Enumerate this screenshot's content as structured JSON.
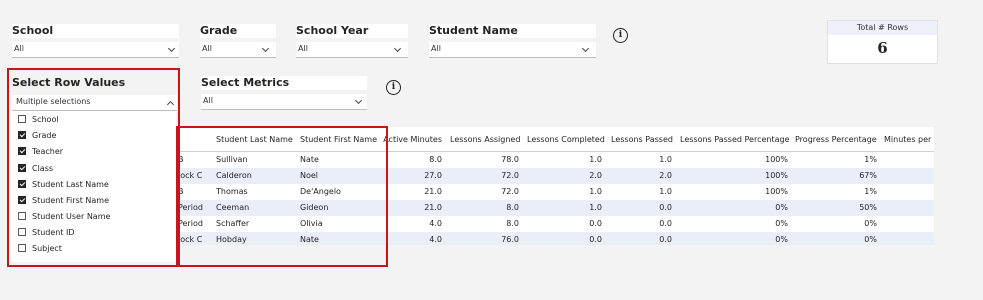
{
  "filters": {
    "school": {
      "title": "School",
      "value": "All"
    },
    "grade": {
      "title": "Grade",
      "value": "All"
    },
    "school_year": {
      "title": "School Year",
      "value": "All"
    },
    "student_name": {
      "title": "Student Name",
      "value": "All"
    },
    "select_row_values": {
      "title": "Select Row Values",
      "value": "Multiple selections"
    },
    "select_metrics": {
      "title": "Select Metrics",
      "value": "All"
    }
  },
  "info_icon_glyph": "i",
  "card": {
    "title": "Total # Rows",
    "value": "6"
  },
  "row_values": [
    {
      "label": "School",
      "checked": false
    },
    {
      "label": "Grade",
      "checked": true
    },
    {
      "label": "Teacher",
      "checked": true
    },
    {
      "label": "Class",
      "checked": true
    },
    {
      "label": "Student Last Name",
      "checked": true
    },
    {
      "label": "Student First Name",
      "checked": true
    },
    {
      "label": "Student User Name",
      "checked": false
    },
    {
      "label": "Student ID",
      "checked": false
    },
    {
      "label": "Subject",
      "checked": false
    }
  ],
  "table": {
    "headers": [
      "Student Last Name",
      "Student First Name",
      "Active Minutes",
      "Lessons Assigned",
      "Lessons Completed",
      "Lessons Passed",
      "Lessons Passed Percentage",
      "Progress Percentage",
      "Minutes per Week"
    ],
    "rows": [
      [
        "B",
        "Sullivan",
        "Nate",
        "8.0",
        "78.0",
        "1.0",
        "1.0",
        "100%",
        "1%"
      ],
      [
        "lock C",
        "Calderon",
        "Noel",
        "27.0",
        "72.0",
        "2.0",
        "2.0",
        "100%",
        "67%"
      ],
      [
        "B",
        "Thomas",
        "De'Angelo",
        "21.0",
        "72.0",
        "1.0",
        "1.0",
        "100%",
        "1%"
      ],
      [
        "Period",
        "Ceeman",
        "Gideon",
        "21.0",
        "8.0",
        "1.0",
        "0.0",
        "0%",
        "50%"
      ],
      [
        "Period",
        "Schaffer",
        "Olivia",
        "4.0",
        "8.0",
        "0.0",
        "0.0",
        "0%",
        "0%"
      ],
      [
        "lock C",
        "Hobday",
        "Nate",
        "4.0",
        "76.0",
        "0.0",
        "0.0",
        "0%",
        "0%"
      ]
    ]
  },
  "colors": {
    "highlight_red": "#c8151b",
    "row_alt": "#e9eef9",
    "card_header": "#eef1fa"
  }
}
